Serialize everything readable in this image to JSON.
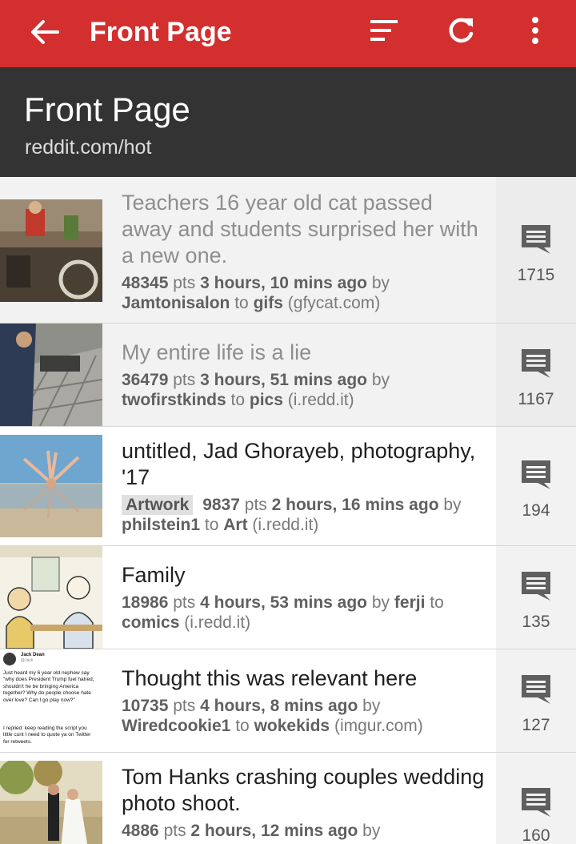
{
  "appbar": {
    "title": "Front Page",
    "back_icon": "arrow-left-icon",
    "sort_icon": "sort-icon",
    "refresh_icon": "refresh-icon",
    "more_icon": "more-vertical-icon",
    "color": "#d32f2f"
  },
  "subheader": {
    "title": "Front Page",
    "subtitle": "reddit.com/hot"
  },
  "posts": [
    {
      "title": "Teachers 16 year old cat passed away and students surprised her with a new one.",
      "points": "48345",
      "pts_label": "pts",
      "time": "3 hours, 10 mins ago",
      "by_label": "by",
      "author": "Jamtonisalon",
      "to_label": "to",
      "subreddit": "gifs",
      "domain": "(gfycat.com)",
      "flair": "",
      "comments": "1715",
      "read": true
    },
    {
      "title": "My entire life is a lie",
      "points": "36479",
      "pts_label": "pts",
      "time": "3 hours, 51 mins ago",
      "by_label": "by",
      "author": "twofirstkinds",
      "to_label": "to",
      "subreddit": "pics",
      "domain": "(i.redd.it)",
      "flair": "",
      "comments": "1167",
      "read": true
    },
    {
      "title": "untitled, Jad Ghorayeb, photography, '17",
      "points": "9837",
      "pts_label": "pts",
      "time": "2 hours, 16 mins ago",
      "by_label": "by",
      "author": "philstein1",
      "to_label": "to",
      "subreddit": "Art",
      "domain": "(i.redd.it)",
      "flair": "Artwork",
      "comments": "194",
      "read": false
    },
    {
      "title": "Family",
      "points": "18986",
      "pts_label": "pts",
      "time": "4 hours, 53 mins ago",
      "by_label": "by",
      "author": "ferji",
      "to_label": "to",
      "subreddit": "comics",
      "domain": "(i.redd.it)",
      "flair": "",
      "comments": "135",
      "read": false
    },
    {
      "title": "Thought this was relevant here",
      "points": "10735",
      "pts_label": "pts",
      "time": "4 hours, 8 mins ago",
      "by_label": "by",
      "author": "Wiredcookie1",
      "to_label": "to",
      "subreddit": "wokekids",
      "domain": "(imgur.com)",
      "flair": "",
      "comments": "127",
      "read": false
    },
    {
      "title": "Tom Hanks crashing couples wedding photo shoot.",
      "points": "4886",
      "pts_label": "pts",
      "time": "2 hours, 12 mins ago",
      "by_label": "by",
      "author": "",
      "to_label": "",
      "subreddit": "",
      "domain": "",
      "flair": "",
      "comments": "160",
      "read": false
    }
  ],
  "tweet_thumb": {
    "name": "Jack Dean",
    "handle": "@Jack",
    "text1": "Just heard my 6 year old nephew say \"why does President Trump fuel hatred, shouldn't he be bringing America together? Why do people choose hate over love? Can I go play now?\"",
    "text2": "I replied: keep reading the script you little cunt I need to quote ya on Twitter for retweets."
  },
  "icons": {
    "comment": "comment-icon"
  }
}
